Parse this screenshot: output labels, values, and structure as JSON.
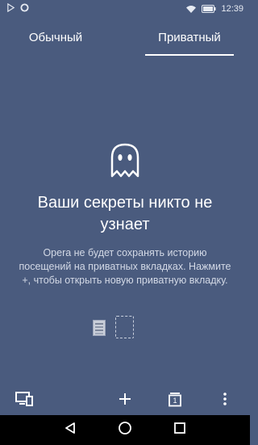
{
  "status_bar": {
    "time": "12:39",
    "battery_icon": "battery-icon",
    "wifi_icon": "wifi-icon",
    "notification_icons": [
      "play-store-icon",
      "opera-icon"
    ]
  },
  "tabs": {
    "normal_label": "Обычный",
    "private_label": "Приватный",
    "selected": "private"
  },
  "content": {
    "icon": "ghost-icon",
    "title": "Ваши секреты никто не узнает",
    "description": "Opera не будет сохранять историю посещений на приватных вкладках. Нажмите +, чтобы открыть новую приватную вкладку."
  },
  "toolbar": {
    "tab_count": "1",
    "icons": [
      "devices-icon",
      "plus-icon",
      "tabs-icon",
      "more-vertical-icon"
    ]
  },
  "nav_bar": {
    "icons": [
      "back-triangle-icon",
      "home-circle-icon",
      "recents-square-icon"
    ]
  },
  "colors": {
    "background": "#4a5b7e",
    "text_primary": "#ffffff",
    "text_secondary": "#d3d9e6",
    "nav_bar": "#000000"
  }
}
